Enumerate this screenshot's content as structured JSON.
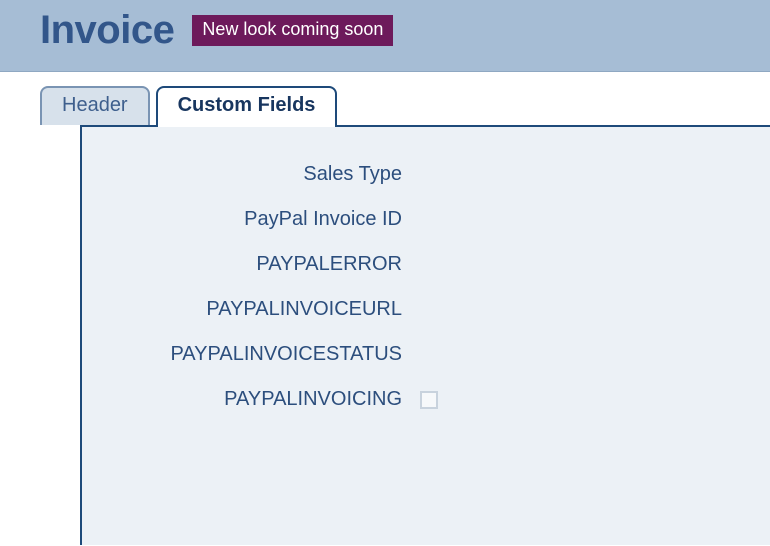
{
  "header": {
    "title": "Invoice",
    "badge": "New look coming soon"
  },
  "tabs": {
    "header": "Header",
    "custom_fields": "Custom Fields"
  },
  "fields": {
    "sales_type": {
      "label": "Sales Type"
    },
    "paypal_invoice_id": {
      "label": "PayPal Invoice ID"
    },
    "paypal_error": {
      "label": "PAYPALERROR"
    },
    "paypal_invoice_url": {
      "label": "PAYPALINVOICEURL"
    },
    "paypal_invoice_status": {
      "label": "PAYPALINVOICESTATUS"
    },
    "paypal_invoicing": {
      "label": "PAYPALINVOICING",
      "checked": false
    }
  }
}
